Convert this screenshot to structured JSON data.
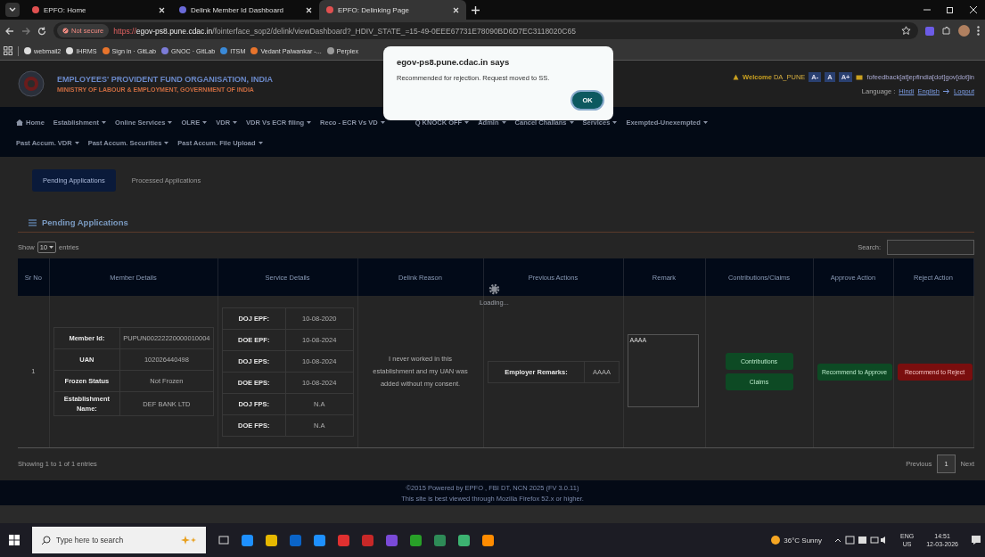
{
  "browser": {
    "tabs": [
      {
        "title": "EPFO: Home",
        "selected": false
      },
      {
        "title": "Delink Member Id Dashboard",
        "selected": false
      },
      {
        "title": "EPFO: Delinking Page",
        "selected": true
      }
    ],
    "address": {
      "security": "Not secure",
      "scheme": "https://",
      "host": "egov-ps8.pune.cdac.in",
      "path": "/fointerface_sop2/delink/viewDashboard?_HDIV_STATE_=15-49-0EEE67731E78090BD6D7EC3118020C65"
    },
    "bookmarks": [
      "webmail2",
      "IHRMS",
      "Sign in · GitLab",
      "GNOC · GitLab",
      "ITSM",
      "Vedant Palwankar -...",
      "Perplex"
    ]
  },
  "header": {
    "org_name": "EMPLOYEES' PROVIDENT FUND ORGANISATION, INDIA",
    "ministry": "MINISTRY OF LABOUR & EMPLOYMENT, GOVERNMENT OF INDIA",
    "welcome": "Welcome",
    "user": "DA_PUNE",
    "font_buttons": [
      "A-",
      "A",
      "A+"
    ],
    "email": "fofeedback[at]epfindia[dot]gov[dot]in",
    "language_label": "Language :",
    "languages": [
      "Hindi",
      "English"
    ],
    "logout": "Logout"
  },
  "nav": {
    "main_menu": [
      "Home",
      "Establishment",
      "Online Services",
      "OLRE",
      "VDR",
      "VDR Vs ECR filing",
      "Reco - ECR Vs VD",
      "Q KNOCK OFF",
      "Admin",
      "Cancel Challans",
      "Services",
      "Exempted-Unexempted"
    ],
    "second_menu": [
      "Past Accum. VDR",
      "Past Accum. Securities",
      "Past Accum. File Upload"
    ]
  },
  "page_tabs": [
    {
      "label": "Pending Applications",
      "selected": true
    },
    {
      "label": "Processed Applications",
      "selected": false
    }
  ],
  "section_title": "Pending Applications",
  "length": {
    "show": "Show",
    "value": "10",
    "entries": "entries"
  },
  "search": {
    "label": "Search:"
  },
  "table": {
    "columns": [
      "Sr No",
      "Member Details",
      "Service Details",
      "Delink Reason",
      "Previous Actions",
      "Remark",
      "Contributions/Claims",
      "Approve Action",
      "Reject Action"
    ],
    "rows": [
      {
        "sr": "1",
        "member": [
          {
            "label": "Member Id:",
            "value": "PUPUN00222220000010004"
          },
          {
            "label": "UAN",
            "value": "102026440498"
          },
          {
            "label": "Frozen Status",
            "value": "Not Frozen"
          },
          {
            "label": "Establishment Name:",
            "value": "DEF BANK LTD"
          }
        ],
        "service": [
          {
            "label": "DOJ EPF:",
            "value": "10-08-2020"
          },
          {
            "label": "DOE EPF:",
            "value": "10-08-2024"
          },
          {
            "label": "DOJ EPS:",
            "value": "10-08-2024"
          },
          {
            "label": "DOE EPS:",
            "value": "10-08-2024"
          },
          {
            "label": "DOJ FPS:",
            "value": "N.A"
          },
          {
            "label": "DOE FPS:",
            "value": "N.A"
          }
        ],
        "reason": "I never worked in this establishment and my UAN was added without my consent.",
        "previous": {
          "label": "Employer Remarks:",
          "value": "AAAA"
        },
        "remark": "AAAA",
        "claims_buttons": [
          "Contributions",
          "Claims"
        ],
        "approve": "Recommend to Approve",
        "reject": "Recommend to Reject"
      }
    ]
  },
  "loading": "Loading...",
  "info": "Showing 1 to 1 of 1 entries",
  "pagination": {
    "previous": "Previous",
    "pages": [
      {
        "label": "1",
        "selected": true
      }
    ],
    "next": "Next"
  },
  "footer": [
    "©2015 Powered by EPFO , FBI DT, NCN 2025 (FV 3.0.11)",
    "This site is best viewed through Mozilla Firefox 52.x or higher."
  ],
  "dialog": {
    "title": "egov-ps8.pune.cdac.in says",
    "message": "Recommended for rejection. Request moved to SS.",
    "button": "OK"
  },
  "taskbar": {
    "search_placeholder": "Type here to search",
    "weather": "36°C Sunny",
    "lang": "ENG",
    "region": "US",
    "time": "14:51",
    "date": "12-03-2026"
  }
}
